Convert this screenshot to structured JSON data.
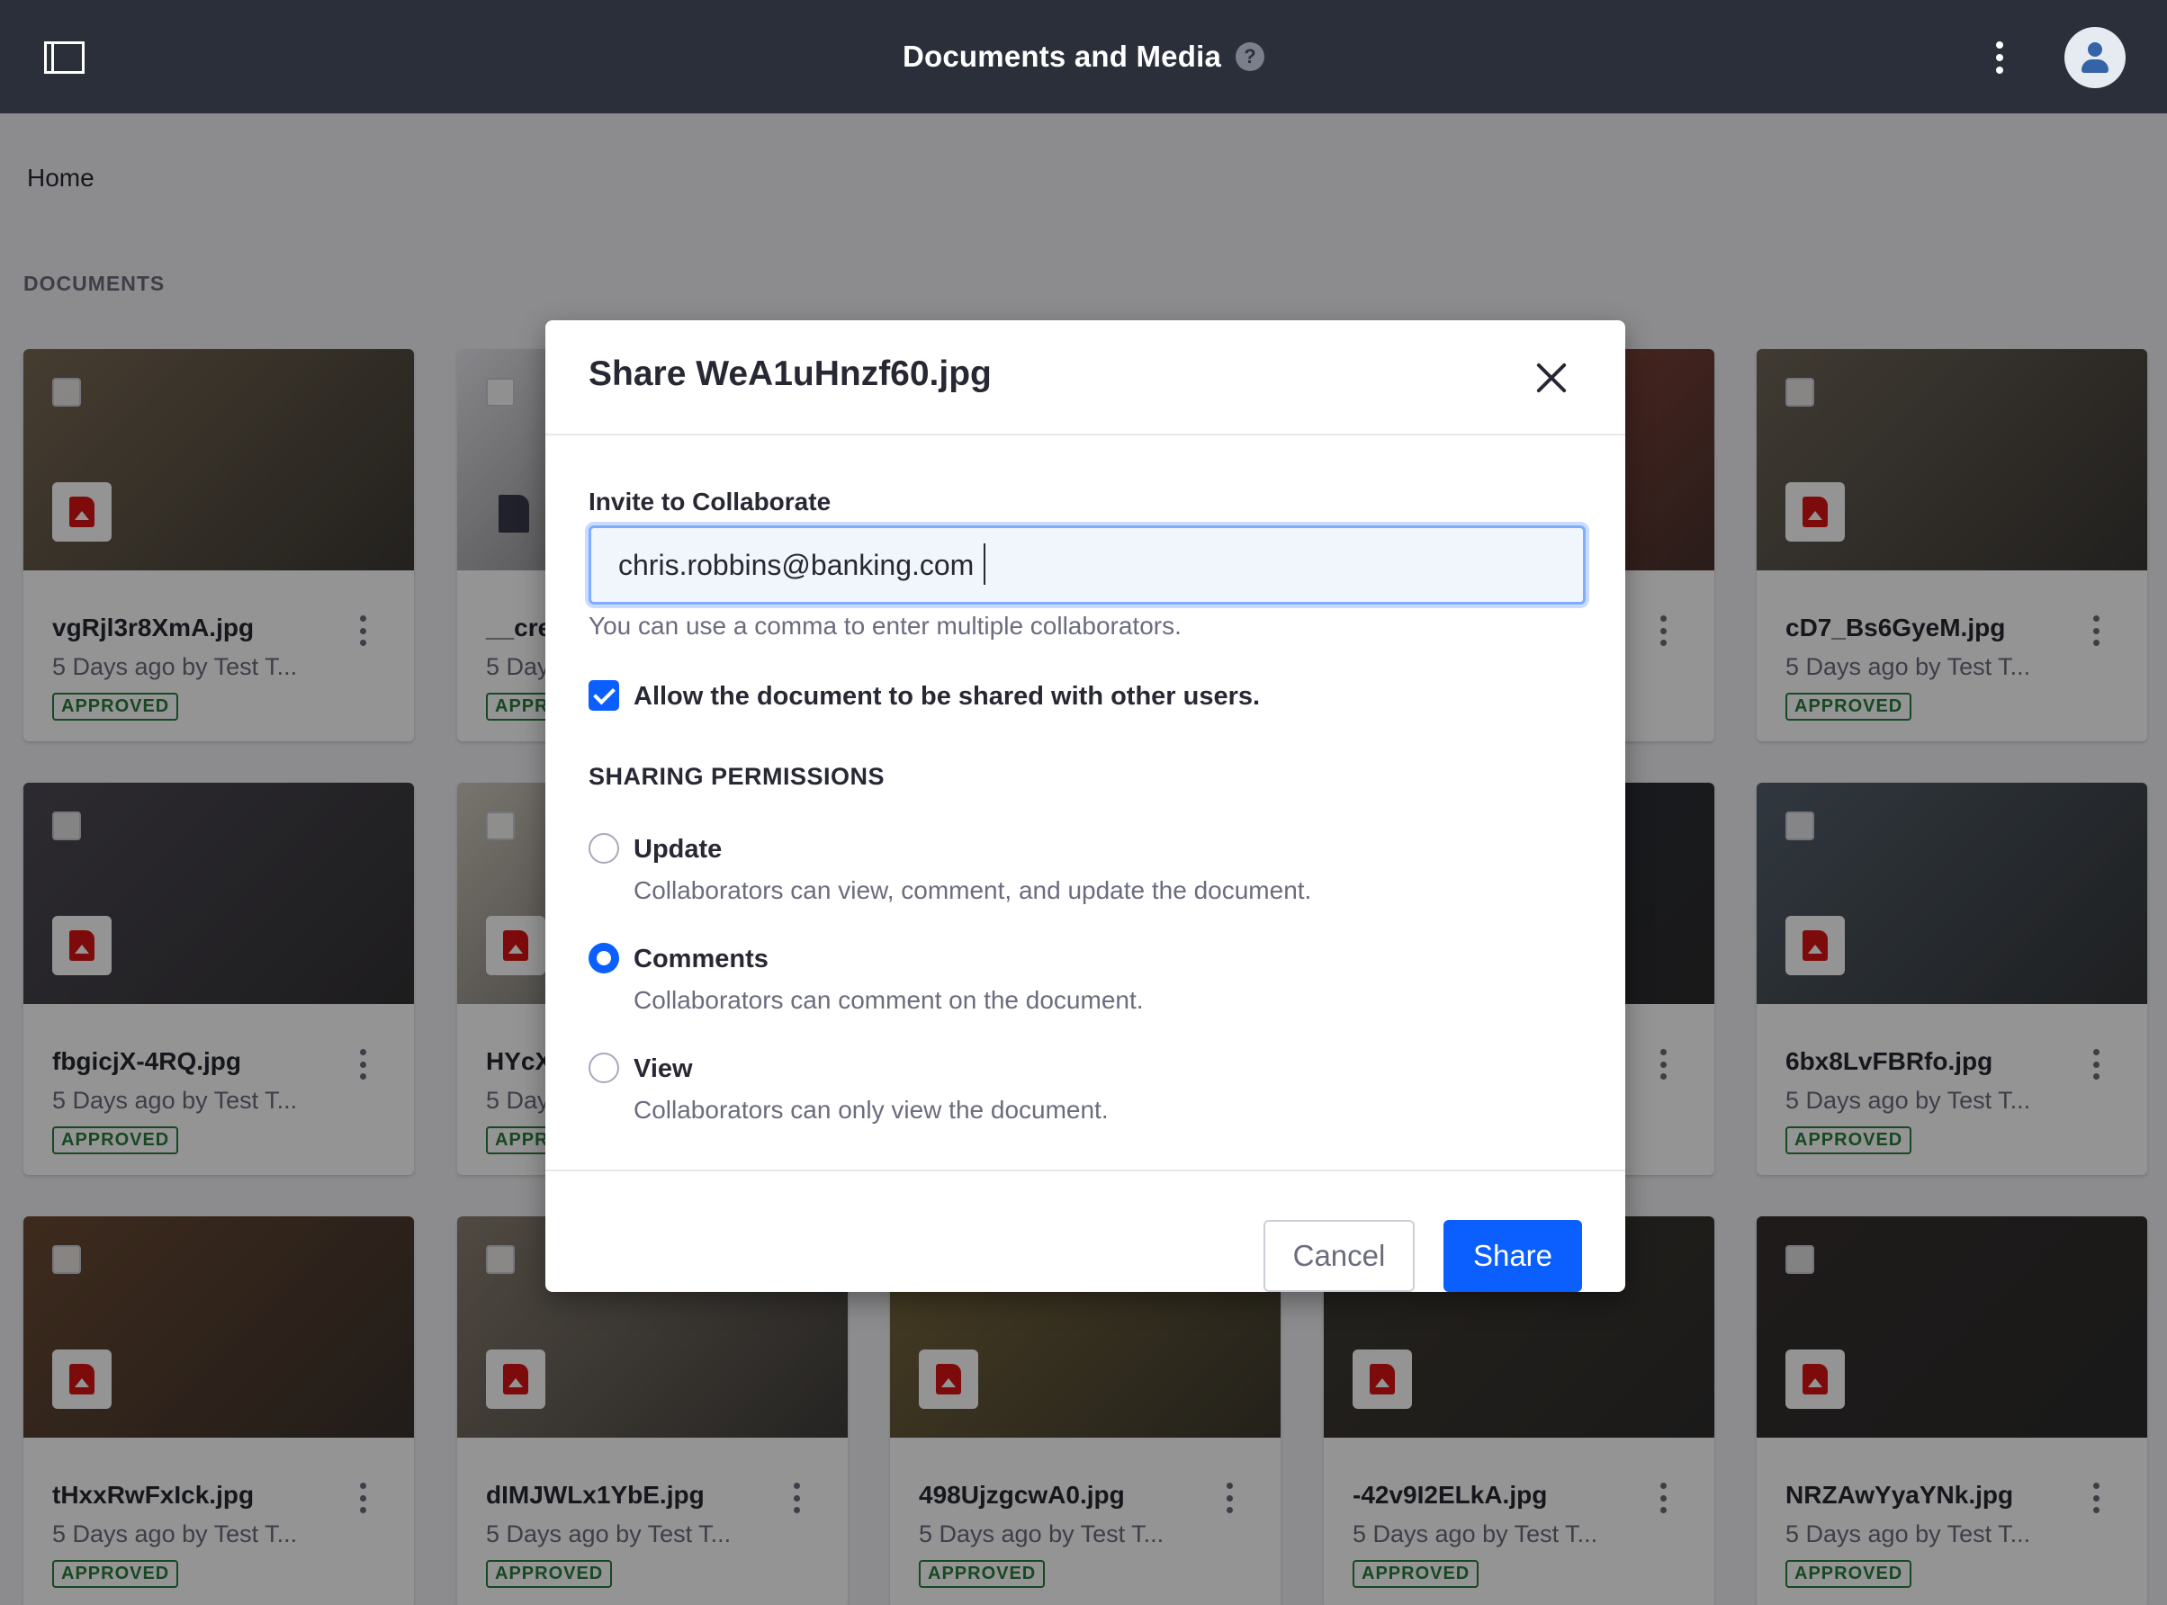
{
  "header": {
    "title": "Documents and Media",
    "help_icon": "?"
  },
  "breadcrumb": "Home",
  "section_title": "DOCUMENTS",
  "cards": [
    {
      "name": "vgRjl3r8XmA.jpg",
      "meta": "5 Days ago by Test T...",
      "status": "APPROVED",
      "thumb_color": "#7a6a55"
    },
    {
      "name": "__cre",
      "meta": "5 Day",
      "status": "APPR",
      "thumb_color": "#e8e8ee"
    },
    {
      "name": "",
      "meta": "",
      "status": "",
      "thumb_color": "#b56a5a"
    },
    {
      "name": "",
      "meta": "",
      "status": "",
      "thumb_color": "#a84b3c"
    },
    {
      "name": "cD7_Bs6GyeM.jpg",
      "meta": "5 Days ago by Test T...",
      "status": "APPROVED",
      "thumb_color": "#6f6558"
    },
    {
      "name": "fbgicjX-4RQ.jpg",
      "meta": "5 Days ago by Test T...",
      "status": "APPROVED",
      "thumb_color": "#4e4a54"
    },
    {
      "name": "HYcX",
      "meta": "5 Day",
      "status": "APPR",
      "thumb_color": "#cfc8bd"
    },
    {
      "name": "",
      "meta": "",
      "status": "",
      "thumb_color": "#3a3d4a"
    },
    {
      "name": "",
      "meta": "",
      "status": "",
      "thumb_color": "#2d3039"
    },
    {
      "name": "6bx8LvFBRfo.jpg",
      "meta": "5 Days ago by Test T...",
      "status": "APPROVED",
      "thumb_color": "#54606c"
    },
    {
      "name": "tHxxRwFxIck.jpg",
      "meta": "5 Days ago by Test T...",
      "status": "APPROVED",
      "thumb_color": "#6b4a33"
    },
    {
      "name": "dIMJWLx1YbE.jpg",
      "meta": "5 Days ago by Test T...",
      "status": "APPROVED",
      "thumb_color": "#8a7f72"
    },
    {
      "name": "498UjzgcwA0.jpg",
      "meta": "5 Days ago by Test T...",
      "status": "APPROVED",
      "thumb_color": "#7b6a3e"
    },
    {
      "name": "-42v9I2ELkA.jpg",
      "meta": "5 Days ago by Test T...",
      "status": "APPROVED",
      "thumb_color": "#3f3a33"
    },
    {
      "name": "NRZAwYyaYNk.jpg",
      "meta": "5 Days ago by Test T...",
      "status": "APPROVED",
      "thumb_color": "#35302e"
    }
  ],
  "modal": {
    "title": "Share WeA1uHnzf60.jpg",
    "invite_label": "Invite to Collaborate",
    "invite_value": "chris.robbins@banking.com",
    "invite_hint": "You can use a comma to enter multiple collaborators.",
    "allow_share_label": "Allow the document to be shared with other users.",
    "allow_share_checked": true,
    "permissions_title": "SHARING PERMISSIONS",
    "permissions": [
      {
        "label": "Update",
        "description": "Collaborators can view, comment, and update the document.",
        "selected": false
      },
      {
        "label": "Comments",
        "description": "Collaborators can comment on the document.",
        "selected": true
      },
      {
        "label": "View",
        "description": "Collaborators can only view the document.",
        "selected": false
      }
    ],
    "cancel_label": "Cancel",
    "share_label": "Share"
  },
  "colors": {
    "primary": "#0b5fff",
    "approved": "#287d3c",
    "topbar": "#2b2f3a"
  }
}
